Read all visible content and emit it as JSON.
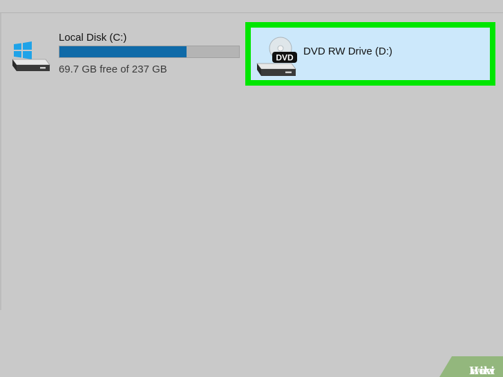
{
  "drives": [
    {
      "name": "Local Disk (C:)",
      "free_text": "69.7 GB free of 237 GB",
      "used_fraction": 0.706,
      "icon": "windows-hard-drive-icon",
      "bar_color": "#0f6aa8"
    },
    {
      "name": "DVD RW Drive (D:)",
      "icon": "dvd-drive-icon",
      "icon_text": "DVD",
      "selected": true
    }
  ],
  "highlight_color": "#00e600",
  "watermark": {
    "prefix": "wiki",
    "suffix": "How"
  }
}
